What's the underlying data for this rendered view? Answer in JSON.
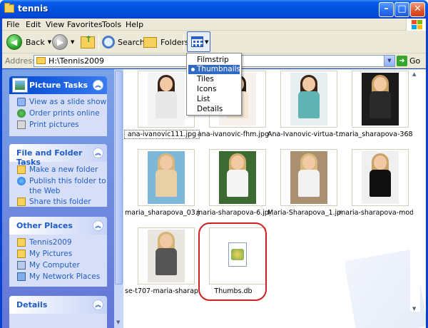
{
  "window": {
    "title": "tennis"
  },
  "menubar": {
    "items": [
      "File",
      "Edit",
      "View",
      "Favorites",
      "Tools",
      "Help"
    ]
  },
  "toolbar": {
    "back_label": "Back",
    "search_label": "Search",
    "folders_label": "Folders"
  },
  "address": {
    "label": "Address",
    "value": "H:\\Tennis2009",
    "go_label": "Go"
  },
  "views_menu": {
    "items": [
      "Filmstrip",
      "Thumbnails",
      "Tiles",
      "Icons",
      "List",
      "Details"
    ],
    "selected": "Thumbnails"
  },
  "left_pane": {
    "picture_tasks": {
      "title": "Picture Tasks",
      "links": [
        "View as a slide show",
        "Order prints online",
        "Print pictures"
      ]
    },
    "file_folder_tasks": {
      "title": "File and Folder Tasks",
      "links": [
        "Make a new folder",
        "Publish this folder to the Web",
        "Share this folder"
      ]
    },
    "other_places": {
      "title": "Other Places",
      "links": [
        "Tennis2009",
        "My Pictures",
        "My Computer",
        "My Network Places"
      ]
    },
    "details": {
      "title": "Details"
    }
  },
  "files": [
    {
      "name": "ana-ivanovic111.jpg",
      "hair": "#3a2418",
      "top": "#e8e8e8",
      "bg": "#f4f4f4"
    },
    {
      "name": "ana-ivanovic-fhm.jpg",
      "hair": "#2b1a10",
      "top": "#f5e6d6",
      "bg": "#f7f2ee"
    },
    {
      "name": "Ana-Ivanovic-virtua-t...",
      "hair": "#3b2416",
      "top": "#5fb3b3",
      "bg": "#e6eef0"
    },
    {
      "name": "maria_sharapova-368...",
      "hair": "#c8a060",
      "top": "#2a2a2a",
      "bg": "#1b1b1b"
    },
    {
      "name": "maria_sharapova_03.jpg",
      "hair": "#d9b877",
      "top": "#e9cfa6",
      "bg": "#7fb7d9"
    },
    {
      "name": "maria-sharapova-6.jpg",
      "hair": "#d2ae6c",
      "top": "#f4f4f4",
      "bg": "#3b6b32"
    },
    {
      "name": "Maria-Sharapova_1.jpg",
      "hair": "#d8b878",
      "top": "#f2f2f2",
      "bg": "#a89070"
    },
    {
      "name": "maria-sharapova-mod...",
      "hair": "#c9a466",
      "top": "#101010",
      "bg": "#f0f0f0"
    },
    {
      "name": "se-t707-maria-sharap...",
      "hair": "#d5b574",
      "top": "#555555",
      "bg": "#e9e6e2"
    },
    {
      "name": "Thumbs.db",
      "hair": "",
      "top": "",
      "bg": ""
    }
  ]
}
